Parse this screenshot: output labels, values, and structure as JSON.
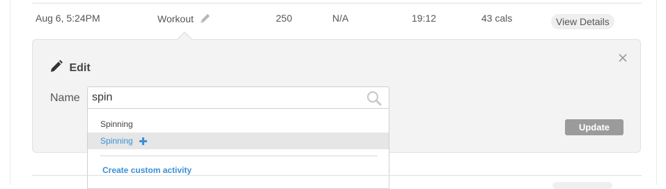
{
  "row": {
    "date": "Aug 6, 5:24PM",
    "activity": "Workout",
    "col3": "250",
    "col4": "N/A",
    "duration": "19:12",
    "calories": "43 cals",
    "view_details_label": "View Details"
  },
  "edit": {
    "title": "Edit",
    "name_label": "Name",
    "name_value": "spin",
    "update_label": "Update"
  },
  "dropdown": {
    "items": [
      {
        "label": "Spinning"
      },
      {
        "label": "Spinning"
      }
    ],
    "create_custom_label": "Create custom activity"
  },
  "colors": {
    "accent_blue": "#3a8fd8",
    "update_button_bg": "#9b9b9b",
    "panel_bg": "#f3f3f3"
  },
  "icons": {
    "row_edit": "pencil-icon",
    "title_edit": "pencil-icon",
    "close": "close-icon",
    "search": "search-icon",
    "add": "plus-icon"
  }
}
